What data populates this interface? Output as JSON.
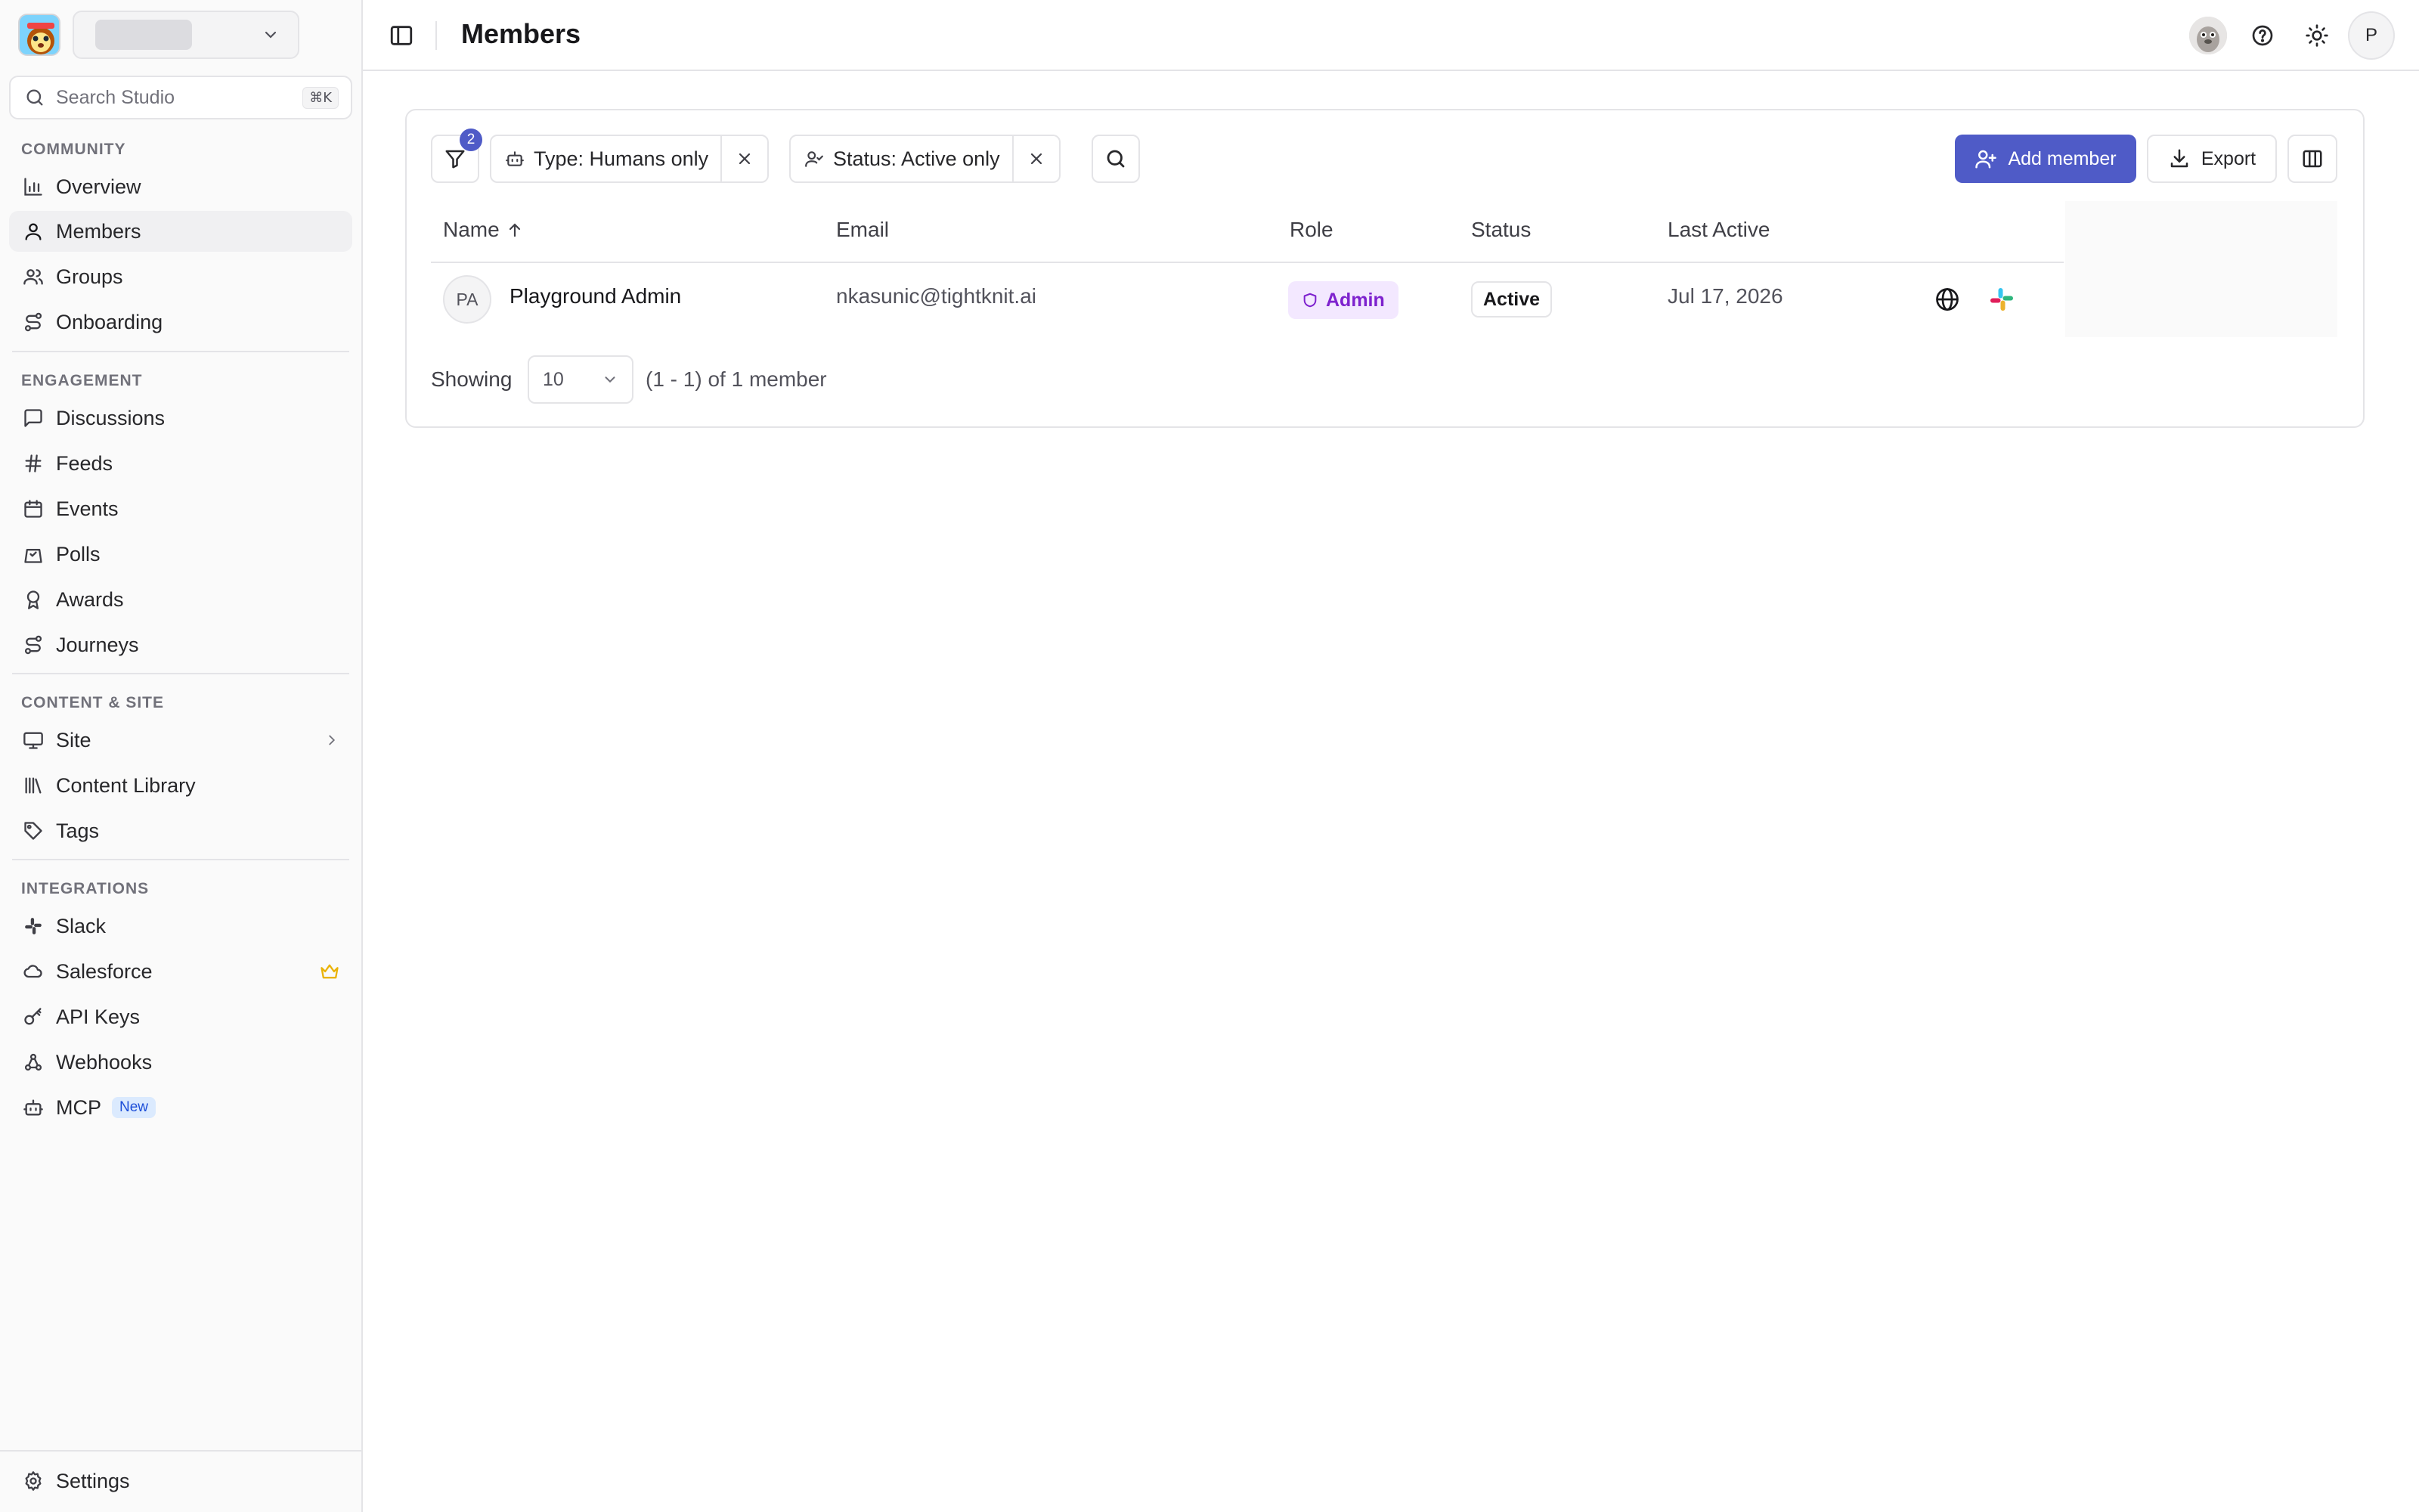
{
  "sidebar": {
    "search_placeholder": "Search Studio",
    "search_shortcut": "⌘K",
    "sections": {
      "community": "COMMUNITY",
      "engagement": "ENGAGEMENT",
      "content": "CONTENT & SITE",
      "integrations": "INTEGRATIONS"
    },
    "items": {
      "overview": "Overview",
      "members": "Members",
      "groups": "Groups",
      "onboarding": "Onboarding",
      "discussions": "Discussions",
      "feeds": "Feeds",
      "events": "Events",
      "polls": "Polls",
      "awards": "Awards",
      "journeys": "Journeys",
      "site": "Site",
      "content_library": "Content Library",
      "tags": "Tags",
      "slack": "Slack",
      "salesforce": "Salesforce",
      "api_keys": "API Keys",
      "webhooks": "Webhooks",
      "mcp": "MCP",
      "mcp_badge": "New",
      "settings": "Settings"
    },
    "active_item": "members"
  },
  "topbar": {
    "title": "Members",
    "user_initial": "P"
  },
  "toolbar": {
    "filter_count": "2",
    "filters": [
      {
        "label": "Type: Humans only"
      },
      {
        "label": "Status: Active only"
      }
    ],
    "add_member_label": "Add member",
    "export_label": "Export"
  },
  "table": {
    "columns": {
      "name": "Name",
      "email": "Email",
      "role": "Role",
      "status": "Status",
      "last_active": "Last Active"
    },
    "sort": {
      "column": "name",
      "direction": "ascending"
    },
    "rows": [
      {
        "initials": "PA",
        "name": "Playground Admin",
        "email": "nkasunic@tightknit.ai",
        "role": "Admin",
        "status": "Active",
        "last_active": "Jul 17, 2026"
      }
    ]
  },
  "pagination": {
    "showing_label": "Showing",
    "page_size": "10",
    "range_text": "(1 - 1) of 1 member"
  },
  "colors": {
    "primary": "#4f5bc7",
    "admin_badge_bg": "#f3e8ff",
    "admin_badge_text": "#7e22ce",
    "crown": "#eab308",
    "new_badge_bg": "#dbeafe"
  }
}
